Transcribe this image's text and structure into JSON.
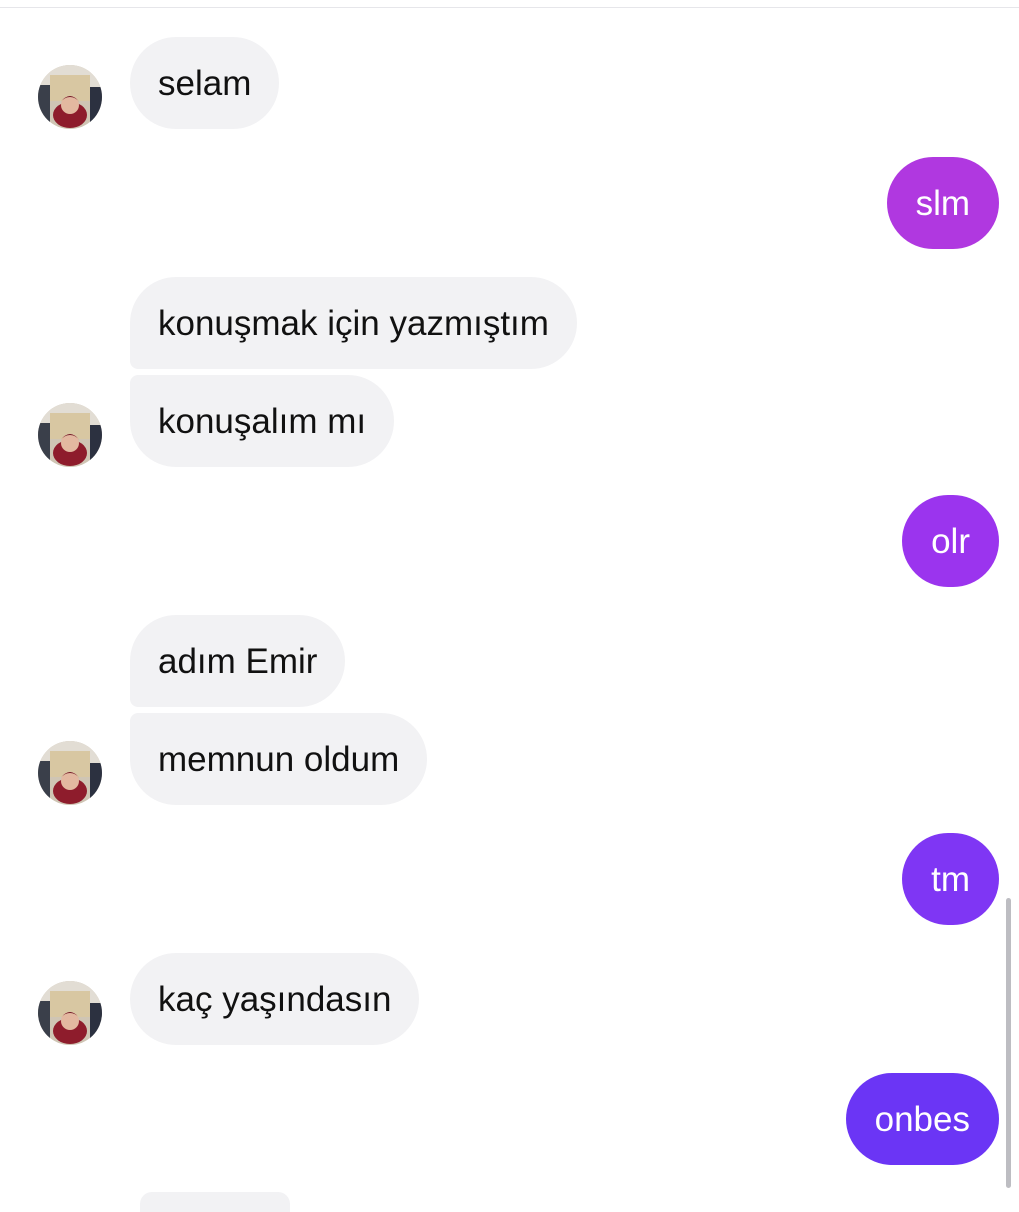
{
  "conversation": {
    "messages": [
      {
        "id": "m1",
        "direction": "received",
        "text": "selam"
      },
      {
        "id": "m2",
        "direction": "sent",
        "text": "slm",
        "color": "#b038e0"
      },
      {
        "id": "m3",
        "direction": "received",
        "text": "konuşmak için yazmıştım"
      },
      {
        "id": "m4",
        "direction": "received",
        "text": "konuşalım mı"
      },
      {
        "id": "m5",
        "direction": "sent",
        "text": "olr",
        "color": "#9b34ee"
      },
      {
        "id": "m6",
        "direction": "received",
        "text": "adım Emir"
      },
      {
        "id": "m7",
        "direction": "received",
        "text": "memnun oldum"
      },
      {
        "id": "m8",
        "direction": "sent",
        "text": "tm",
        "color": "#7f36f4"
      },
      {
        "id": "m9",
        "direction": "received",
        "text": "kaç yaşındasın"
      },
      {
        "id": "m10",
        "direction": "sent",
        "text": "onbes",
        "color": "#6b35f5"
      }
    ]
  },
  "colors": {
    "received_bubble": "#f2f2f4",
    "received_text": "#111111",
    "sent_text": "#ffffff",
    "background": "#ffffff"
  },
  "icons": {
    "avatar": "contact-avatar-photo"
  }
}
